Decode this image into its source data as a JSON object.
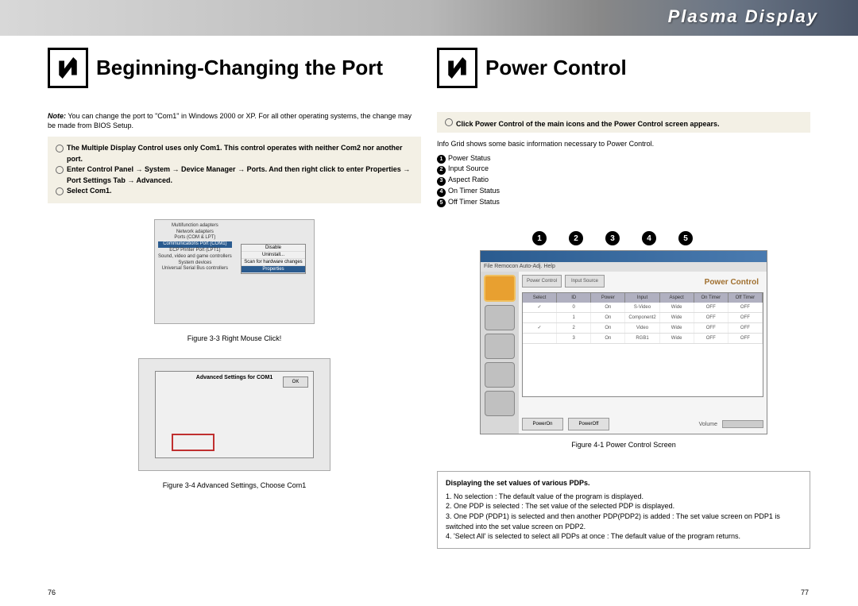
{
  "header": {
    "brand": "Plasma Display"
  },
  "left": {
    "title": "Beginning-Changing the Port",
    "note_label": "Note:",
    "note_text": "You can change the port to \"Com1\" in Windows 2000 or XP. For all other operating systems, the change may be made from BIOS Setup.",
    "info_lines": [
      "The Multiple Display Control uses only Com1. This control operates with neither Com2 nor another port.",
      "Enter Control Panel → System → Device Manager → Ports. And then right click to enter Properties → Port Settings Tab → Advanced.",
      "Select Com1."
    ],
    "fig1_caption": "Figure 3-3 Right Mouse Click!",
    "fig2_caption": "Figure 3-4 Advanced Settings, Choose Com1",
    "fig1_tree": [
      "Multifunction adapters",
      "Network adapters",
      "Ports (COM & LPT)",
      "Communications Port (COM1)",
      "ECP Printer Port (LPT1)",
      "Sound, video and game controllers",
      "System devices",
      "Universal Serial Bus controllers"
    ],
    "fig1_menu": [
      "Disable",
      "Uninstall...",
      "Scan for hardware changes",
      "Properties"
    ]
  },
  "right": {
    "title": "Power Control",
    "infobox": "Click Power Control of the main icons and the Power Control screen appears.",
    "intro": "Info Grid shows some basic information necessary to Power Control.",
    "items": [
      "Power Status",
      "Input Source",
      "Aspect Ratio",
      "On Timer Status",
      "Off Timer Status"
    ],
    "app": {
      "menu": "File   Remocon   Auto-Adj.   Help",
      "pc": "Power Control",
      "hb": [
        "Power Control",
        "Input Source"
      ],
      "gh": [
        "Select",
        "ID",
        "Power",
        "Input",
        "Aspect",
        "On Timer",
        "Off Timer"
      ],
      "rows": [
        [
          "✓",
          "0",
          "On",
          "S-Video",
          "Wide",
          "OFF",
          "OFF"
        ],
        [
          "",
          "1",
          "On",
          "Component2",
          "Wide",
          "OFF",
          "OFF"
        ],
        [
          "✓",
          "2",
          "On",
          "Video",
          "Wide",
          "OFF",
          "OFF"
        ],
        [
          "",
          "3",
          "On",
          "RGB1",
          "Wide",
          "OFF",
          "OFF"
        ]
      ],
      "footer": [
        "PowerOn",
        "PowerOff"
      ],
      "volume": "Volume"
    },
    "fig_caption": "Figure 4-1 Power Control Screen",
    "display_title": "Displaying the set values of various PDPs.",
    "display_items": [
      "No selection : The default value of the program is displayed.",
      "One PDP is selected : The set value of the selected PDP is displayed.",
      "One PDP (PDP1) is selected and then another PDP(PDP2) is added : The set value screen on PDP1 is switched into the set value screen on PDP2.",
      "'Select All' is selected to select all PDPs at once : The default value of the program returns."
    ]
  },
  "pages": {
    "left": "76",
    "right": "77"
  }
}
